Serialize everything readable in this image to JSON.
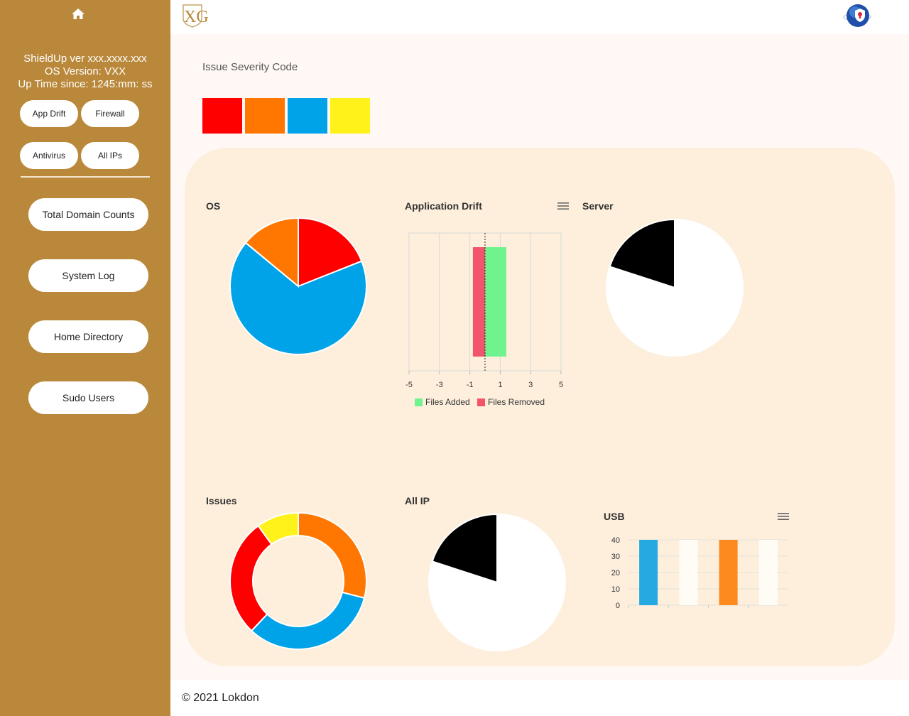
{
  "sidebar": {
    "home_icon": "home-icon",
    "version_line": "ShieldUp ver xxx.xxxx.xxx",
    "os_line": "OS Version: VXX",
    "uptime_line": "Up Time since: 1245:mm: ss",
    "quick_buttons": [
      "App Drift",
      "Firewall",
      "Antivirus",
      "All IPs"
    ],
    "nav_buttons": [
      "Total Domain Counts",
      "System Log",
      "Home Directory",
      "Sudo Users"
    ]
  },
  "header": {
    "logo_text": "XG",
    "user_icon": "globe-shield-icon"
  },
  "main": {
    "severity_title": "Issue Severity Code",
    "severity_colors": [
      "#ff0000",
      "#ff7700",
      "#00a2e8",
      "#fff11a"
    ]
  },
  "footer": {
    "text": "© 2021 Lokdon"
  },
  "chart_data": [
    {
      "type": "pie",
      "title": "OS",
      "slices": [
        {
          "value": 19,
          "color": "#ff0000"
        },
        {
          "value": 67,
          "color": "#00a2e8"
        },
        {
          "value": 14,
          "color": "#ff7700"
        }
      ]
    },
    {
      "type": "bar",
      "orientation": "horizontal",
      "stacked": true,
      "title": "Application Drift",
      "x_ticks": [
        -5,
        -3,
        -1,
        1,
        3,
        5
      ],
      "xlim": [
        -5,
        5
      ],
      "series": [
        {
          "name": "Files Added",
          "values": [
            1.4
          ],
          "color": "#6ef38f"
        },
        {
          "name": "Files Removed",
          "values": [
            -0.8
          ],
          "color": "#f2556b"
        }
      ],
      "legend_position": "bottom",
      "grid": true
    },
    {
      "type": "pie",
      "title": "Server",
      "slices": [
        {
          "value": 80,
          "color": "#ffffff"
        },
        {
          "value": 20,
          "color": "#000000"
        }
      ]
    },
    {
      "type": "pie",
      "subtype": "doughnut",
      "title": "Issues",
      "slices": [
        {
          "value": 29,
          "color": "#ff7700"
        },
        {
          "value": 33,
          "color": "#00a2e8"
        },
        {
          "value": 28,
          "color": "#ff0000"
        },
        {
          "value": 10,
          "color": "#fff11a"
        }
      ]
    },
    {
      "type": "pie",
      "title": "All IP",
      "slices": [
        {
          "value": 80,
          "color": "#ffffff"
        },
        {
          "value": 20,
          "color": "#000000"
        }
      ]
    },
    {
      "type": "bar",
      "title": "USB",
      "y_ticks": [
        0,
        10,
        20,
        30,
        40
      ],
      "ylim": [
        0,
        40
      ],
      "values": [
        40,
        40,
        40,
        40
      ],
      "colors": [
        "#26a9e0",
        "#fffbf5",
        "#fd8a1e",
        "#fffbf5"
      ],
      "grid": true
    }
  ]
}
